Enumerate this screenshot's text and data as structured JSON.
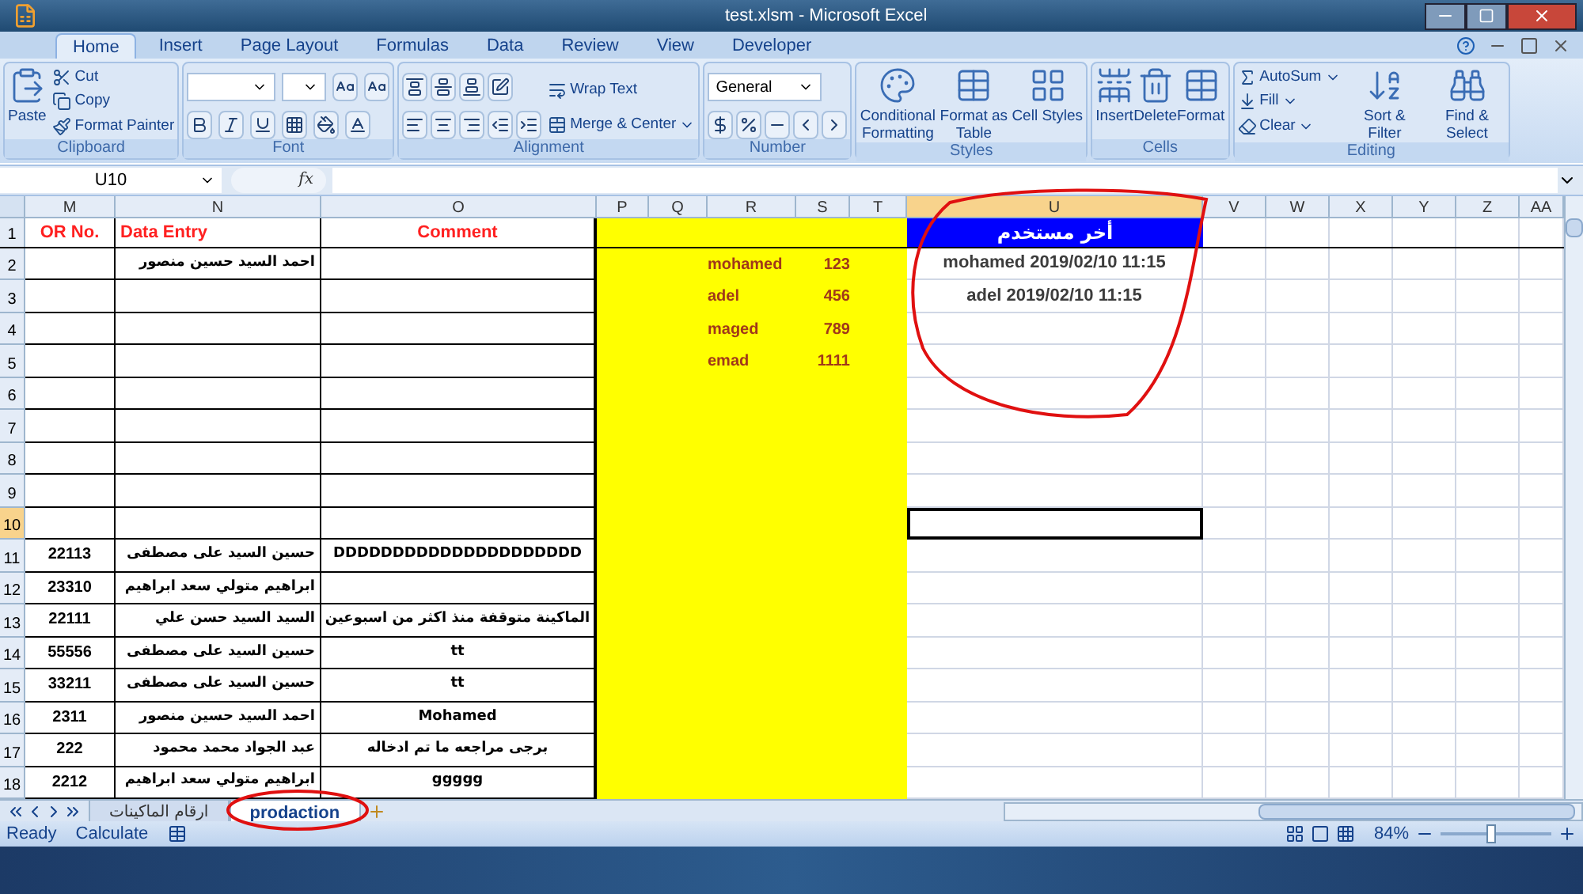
{
  "window": {
    "title": "test.xlsm - Microsoft Excel"
  },
  "ribbon_tabs": [
    {
      "label": "Home",
      "selected": true
    },
    {
      "label": "Insert",
      "selected": false
    },
    {
      "label": "Page Layout",
      "selected": false
    },
    {
      "label": "Formulas",
      "selected": false
    },
    {
      "label": "Data",
      "selected": false
    },
    {
      "label": "Review",
      "selected": false
    },
    {
      "label": "View",
      "selected": false
    },
    {
      "label": "Developer",
      "selected": false
    }
  ],
  "ribbon_groups": [
    {
      "name": "Clipboard",
      "kind": "clipboard",
      "items": [
        "Paste",
        "Cut",
        "Copy",
        "Format Painter"
      ]
    },
    {
      "name": "Font",
      "kind": "font"
    },
    {
      "name": "Alignment",
      "kind": "alignment",
      "items": [
        "Wrap Text",
        "Merge & Center"
      ]
    },
    {
      "name": "Number",
      "kind": "number",
      "items": [
        "General"
      ]
    },
    {
      "name": "Styles",
      "kind": "large",
      "items": [
        "Conditional Formatting",
        "Format as Table",
        "Cell Styles"
      ]
    },
    {
      "name": "Cells",
      "kind": "large",
      "items": [
        "Insert",
        "Delete",
        "Format"
      ]
    },
    {
      "name": "Editing",
      "kind": "editing",
      "items": [
        "AutoSum",
        "Fill",
        "Clear",
        "Sort & Filter",
        "Find & Select"
      ]
    }
  ],
  "formula_bar": {
    "name_box": "U10",
    "fx": "fx"
  },
  "columns": [
    {
      "label": "M",
      "selected": false
    },
    {
      "label": "N",
      "selected": false
    },
    {
      "label": "O",
      "selected": false
    },
    {
      "label": "P",
      "selected": false
    },
    {
      "label": "Q",
      "selected": false
    },
    {
      "label": "R",
      "selected": false
    },
    {
      "label": "S",
      "selected": false
    },
    {
      "label": "T",
      "selected": false
    },
    {
      "label": "U",
      "selected": true
    },
    {
      "label": "V",
      "selected": false
    },
    {
      "label": "W",
      "selected": false
    },
    {
      "label": "X",
      "selected": false
    },
    {
      "label": "Y",
      "selected": false
    },
    {
      "label": "Z",
      "selected": false
    },
    {
      "label": "AA",
      "selected": false
    }
  ],
  "header_row": {
    "row": "1",
    "or_no": "OR No.",
    "data_entry": "Data Entry",
    "comment": "Comment",
    "last_user": "أخر مستخدم"
  },
  "rows": [
    {
      "row": "2",
      "selected": false,
      "data_entry": "احمد السيد حسين منصور",
      "user": "mohamed",
      "code": "123",
      "last_user": "mohamed  2019/02/10  11:15"
    },
    {
      "row": "3",
      "selected": false,
      "user": "adel",
      "code": "456",
      "last_user": "adel  2019/02/10  11:15"
    },
    {
      "row": "4",
      "selected": false,
      "user": "maged",
      "code": "789"
    },
    {
      "row": "5",
      "selected": false,
      "user": "emad",
      "code": "1111"
    },
    {
      "row": "6",
      "selected": false
    },
    {
      "row": "7",
      "selected": false
    },
    {
      "row": "8",
      "selected": false
    },
    {
      "row": "9",
      "selected": false
    },
    {
      "row": "10",
      "selected": true
    },
    {
      "row": "11",
      "selected": false,
      "or_no": "22113",
      "data_entry": "حسين السيد على مصطفى",
      "comment": "DDDDDDDDDDDDDDDDDDDDD"
    },
    {
      "row": "12",
      "selected": false,
      "or_no": "23310",
      "data_entry": "ابراهيم متولي سعد ابراهيم"
    },
    {
      "row": "13",
      "selected": false,
      "or_no": "22111",
      "data_entry": "السيد السيد حسن علي",
      "comment": "الماكينة متوقفة منذ اكثر من اسبوعين"
    },
    {
      "row": "14",
      "selected": false,
      "or_no": "55556",
      "data_entry": "حسين السيد على مصطفى",
      "comment": "tt"
    },
    {
      "row": "15",
      "selected": false,
      "or_no": "33211",
      "data_entry": "حسين السيد على مصطفى",
      "comment": "tt"
    },
    {
      "row": "16",
      "selected": false,
      "or_no": "2311",
      "data_entry": "احمد السيد حسين منصور",
      "comment": "Mohamed"
    },
    {
      "row": "17",
      "selected": false,
      "or_no": "222",
      "data_entry": "عبد الجواد محمد محمود",
      "comment": "برجى مراجعه ما  تم  ادخاله"
    },
    {
      "row": "18",
      "selected": false,
      "or_no": "2212",
      "data_entry": "ابراهيم متولي سعد ابراهيم",
      "comment": "ggggg"
    }
  ],
  "sheet_tabs": [
    {
      "label": "ارقام الماكينات",
      "selected": false
    },
    {
      "label": "prodaction",
      "selected": true
    }
  ],
  "status_bar": {
    "items": [
      "Ready",
      "Calculate"
    ],
    "zoom": "84%",
    "zoom_slider": {
      "level": 0.45
    }
  }
}
